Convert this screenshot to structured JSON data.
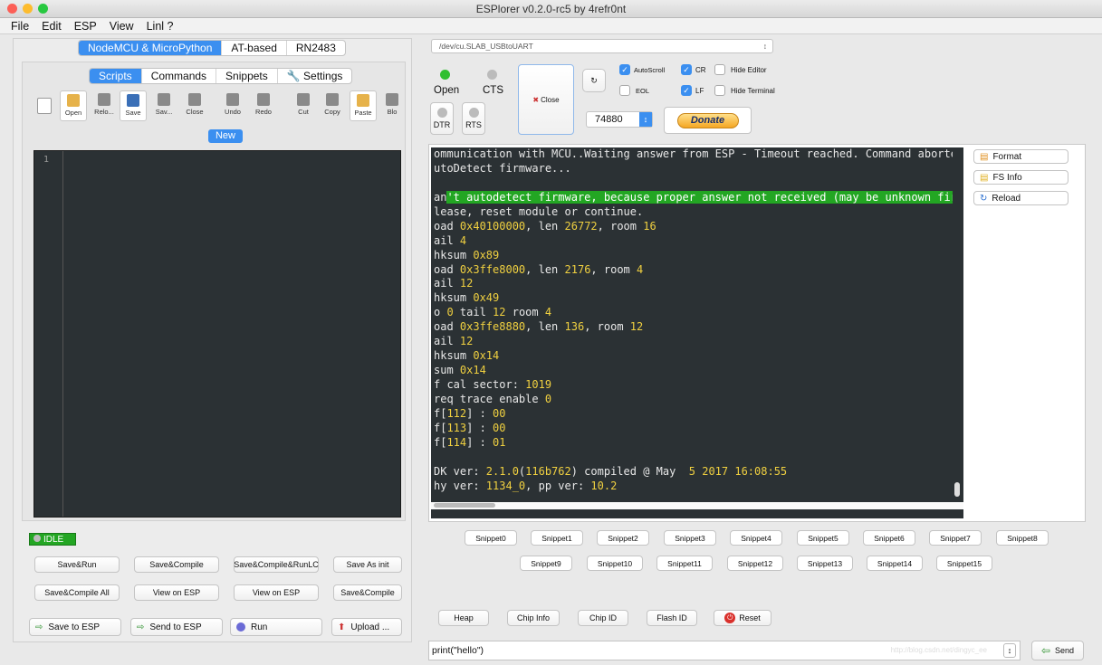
{
  "window": {
    "title": "ESPlorer v0.2.0-rc5 by 4refr0nt"
  },
  "menu": [
    "File",
    "Edit",
    "ESP",
    "View",
    "Linl ?"
  ],
  "left": {
    "top_tabs": [
      "NodeMCU & MicroPython",
      "AT-based",
      "RN2483"
    ],
    "sub_tabs": [
      "Scripts",
      "Commands",
      "Snippets",
      "Settings"
    ],
    "toolbar": [
      "Open",
      "Relo...",
      "Save",
      "Sav...",
      "Close",
      "Undo",
      "Redo",
      "Cut",
      "Copy",
      "Paste",
      "Blo"
    ],
    "new_tab": "New",
    "line_number": "1",
    "status": "IDLE",
    "row1": [
      "Save&Run",
      "Save&Compile",
      "Save&Compile&RunLC",
      "Save As init"
    ],
    "row2": [
      "Save&Compile All",
      "View on ESP",
      "View on ESP",
      "Save&Compile"
    ],
    "row3": [
      "Save to ESP",
      "Send to ESP",
      "Run",
      "Upload ..."
    ]
  },
  "right": {
    "port": "/dev/cu.SLAB_USBtoUART",
    "open": "Open",
    "cts": "CTS",
    "close": "Close",
    "dtr": "DTR",
    "rts": "RTS",
    "baud": "74880",
    "donate": "Donate",
    "checks": {
      "autoscroll": "AutoScroll",
      "cr": "CR",
      "hide_editor": "Hide Editor",
      "eol": "EOL",
      "lf": "LF",
      "hide_terminal": "Hide Terminal"
    },
    "side": [
      "Format",
      "FS Info",
      "Reload"
    ],
    "snippets1": [
      "Snippet0",
      "Snippet1",
      "Snippet2",
      "Snippet3",
      "Snippet4",
      "Snippet5",
      "Snippet6",
      "Snippet7",
      "Snippet8"
    ],
    "snippets2": [
      "Snippet9",
      "Snippet10",
      "Snippet11",
      "Snippet12",
      "Snippet13",
      "Snippet14",
      "Snippet15"
    ],
    "bottom": [
      "Heap",
      "Chip Info",
      "Chip ID",
      "Flash ID",
      "Reset"
    ],
    "command": "print(\"hello\")",
    "send": "Send",
    "watermark": "http://blog.csdn.net/dingyc_ee"
  },
  "terminal": [
    [
      [
        "ommunication with MCU..Waiting answer from ESP - Timeout reached. Command aborted.Got",
        ""
      ]
    ],
    [
      [
        "utoDetect firmware...",
        ""
      ]
    ],
    [
      [
        "",
        ""
      ]
    ],
    [
      [
        "an",
        ""
      ],
      [
        "'t autodetect firmware, because proper answer not received (may be unknown firmware)",
        "hl"
      ]
    ],
    [
      [
        "lease, reset module or continue.",
        ""
      ]
    ],
    [
      [
        "oad ",
        ""
      ],
      [
        "0x40100000",
        "y"
      ],
      [
        ", len ",
        ""
      ],
      [
        "26772",
        "y"
      ],
      [
        ", room ",
        ""
      ],
      [
        "16",
        "y"
      ]
    ],
    [
      [
        "ail ",
        ""
      ],
      [
        "4",
        "y"
      ]
    ],
    [
      [
        "hksum ",
        ""
      ],
      [
        "0x89",
        "y"
      ]
    ],
    [
      [
        "oad ",
        ""
      ],
      [
        "0x3ffe8000",
        "y"
      ],
      [
        ", len ",
        ""
      ],
      [
        "2176",
        "y"
      ],
      [
        ", room ",
        ""
      ],
      [
        "4",
        "y"
      ]
    ],
    [
      [
        "ail ",
        ""
      ],
      [
        "12",
        "y"
      ]
    ],
    [
      [
        "hksum ",
        ""
      ],
      [
        "0x49",
        "y"
      ]
    ],
    [
      [
        "o ",
        ""
      ],
      [
        "0",
        "y"
      ],
      [
        " tail ",
        ""
      ],
      [
        "12",
        "y"
      ],
      [
        " room ",
        ""
      ],
      [
        "4",
        "y"
      ]
    ],
    [
      [
        "oad ",
        ""
      ],
      [
        "0x3ffe8880",
        "y"
      ],
      [
        ", len ",
        ""
      ],
      [
        "136",
        "y"
      ],
      [
        ", room ",
        ""
      ],
      [
        "12",
        "y"
      ]
    ],
    [
      [
        "ail ",
        ""
      ],
      [
        "12",
        "y"
      ]
    ],
    [
      [
        "hksum ",
        ""
      ],
      [
        "0x14",
        "y"
      ]
    ],
    [
      [
        "sum ",
        ""
      ],
      [
        "0x14",
        "y"
      ]
    ],
    [
      [
        "f cal sector: ",
        ""
      ],
      [
        "1019",
        "y"
      ]
    ],
    [
      [
        "req trace enable ",
        ""
      ],
      [
        "0",
        "y"
      ]
    ],
    [
      [
        "f[",
        ""
      ],
      [
        "112",
        "y"
      ],
      [
        "] : ",
        ""
      ],
      [
        "00",
        "y"
      ]
    ],
    [
      [
        "f[",
        ""
      ],
      [
        "113",
        "y"
      ],
      [
        "] : ",
        ""
      ],
      [
        "00",
        "y"
      ]
    ],
    [
      [
        "f[",
        ""
      ],
      [
        "114",
        "y"
      ],
      [
        "] : ",
        ""
      ],
      [
        "01",
        "y"
      ]
    ],
    [
      [
        "",
        ""
      ]
    ],
    [
      [
        "DK ver: ",
        ""
      ],
      [
        "2.1.0",
        "y"
      ],
      [
        "(",
        ""
      ],
      [
        "116b762",
        "y"
      ],
      [
        ") compiled @ May  ",
        ""
      ],
      [
        "5 2017 16:08:55",
        "y"
      ]
    ],
    [
      [
        "hy ver: ",
        ""
      ],
      [
        "1134_0",
        "y"
      ],
      [
        ", pp ver: ",
        ""
      ],
      [
        "10.2",
        "y"
      ]
    ]
  ]
}
